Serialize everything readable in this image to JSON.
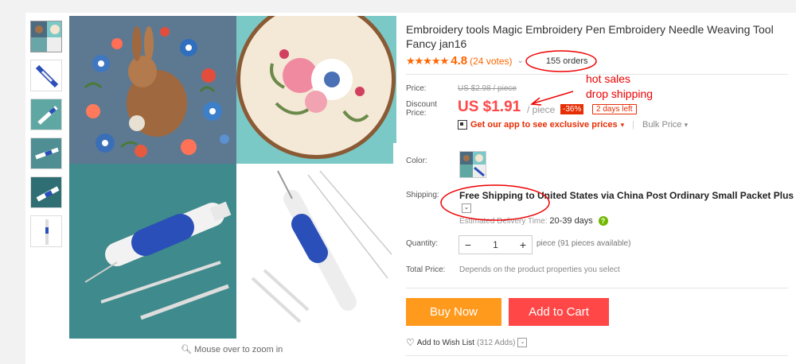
{
  "product": {
    "title": "Embroidery tools Magic Embroidery Pen Embroidery Needle Weaving Tool Fancy jan16",
    "stars": "★★★★★",
    "rating": "4.8",
    "votes": "(24 votes)",
    "orders": "155 orders"
  },
  "price": {
    "price_label": "Price:",
    "old_price": "US $2.98 / piece",
    "discount_label_1": "Discount",
    "discount_label_2": "Price:",
    "current": "US $1.91",
    "per": "/ piece",
    "discount": "-36%",
    "days_left": "2 days left",
    "app_text": "Get our app to see exclusive prices",
    "bulk_price": "Bulk Price"
  },
  "options": {
    "color_label": "Color:",
    "shipping_label": "Shipping:",
    "shipping_text": "Free Shipping to United States via China Post Ordinary Small Packet Plus",
    "delivery_label": "Estimated Delivery Time:",
    "delivery_value": "20-39 days",
    "quantity_label": "Quantity:",
    "quantity_value": "1",
    "quantity_note": "piece (91 pieces available)",
    "total_label": "Total Price:",
    "total_note": "Depends on the product properties you select"
  },
  "actions": {
    "buy_now": "Buy Now",
    "add_to_cart": "Add to Cart",
    "wishlist": "Add to Wish List",
    "wishlist_adds": "(312 Adds)"
  },
  "gallery": {
    "zoom_hint": "Mouse over to zoom in"
  },
  "annotations": {
    "hot_sales": "hot sales",
    "drop_shipping": "drop shipping"
  },
  "colors": {
    "accent_red": "#ff4747",
    "orange": "#ff9a1d",
    "annotation_red": "#e00000"
  }
}
